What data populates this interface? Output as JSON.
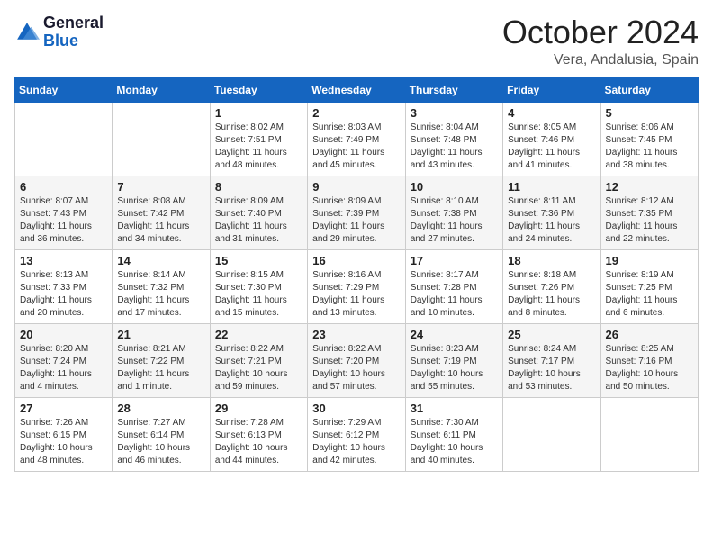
{
  "header": {
    "logo_general": "General",
    "logo_blue": "Blue",
    "month": "October 2024",
    "location": "Vera, Andalusia, Spain"
  },
  "days_of_week": [
    "Sunday",
    "Monday",
    "Tuesday",
    "Wednesday",
    "Thursday",
    "Friday",
    "Saturday"
  ],
  "weeks": [
    [
      {
        "day": "",
        "detail": ""
      },
      {
        "day": "",
        "detail": ""
      },
      {
        "day": "1",
        "detail": "Sunrise: 8:02 AM\nSunset: 7:51 PM\nDaylight: 11 hours and 48 minutes."
      },
      {
        "day": "2",
        "detail": "Sunrise: 8:03 AM\nSunset: 7:49 PM\nDaylight: 11 hours and 45 minutes."
      },
      {
        "day": "3",
        "detail": "Sunrise: 8:04 AM\nSunset: 7:48 PM\nDaylight: 11 hours and 43 minutes."
      },
      {
        "day": "4",
        "detail": "Sunrise: 8:05 AM\nSunset: 7:46 PM\nDaylight: 11 hours and 41 minutes."
      },
      {
        "day": "5",
        "detail": "Sunrise: 8:06 AM\nSunset: 7:45 PM\nDaylight: 11 hours and 38 minutes."
      }
    ],
    [
      {
        "day": "6",
        "detail": "Sunrise: 8:07 AM\nSunset: 7:43 PM\nDaylight: 11 hours and 36 minutes."
      },
      {
        "day": "7",
        "detail": "Sunrise: 8:08 AM\nSunset: 7:42 PM\nDaylight: 11 hours and 34 minutes."
      },
      {
        "day": "8",
        "detail": "Sunrise: 8:09 AM\nSunset: 7:40 PM\nDaylight: 11 hours and 31 minutes."
      },
      {
        "day": "9",
        "detail": "Sunrise: 8:09 AM\nSunset: 7:39 PM\nDaylight: 11 hours and 29 minutes."
      },
      {
        "day": "10",
        "detail": "Sunrise: 8:10 AM\nSunset: 7:38 PM\nDaylight: 11 hours and 27 minutes."
      },
      {
        "day": "11",
        "detail": "Sunrise: 8:11 AM\nSunset: 7:36 PM\nDaylight: 11 hours and 24 minutes."
      },
      {
        "day": "12",
        "detail": "Sunrise: 8:12 AM\nSunset: 7:35 PM\nDaylight: 11 hours and 22 minutes."
      }
    ],
    [
      {
        "day": "13",
        "detail": "Sunrise: 8:13 AM\nSunset: 7:33 PM\nDaylight: 11 hours and 20 minutes."
      },
      {
        "day": "14",
        "detail": "Sunrise: 8:14 AM\nSunset: 7:32 PM\nDaylight: 11 hours and 17 minutes."
      },
      {
        "day": "15",
        "detail": "Sunrise: 8:15 AM\nSunset: 7:30 PM\nDaylight: 11 hours and 15 minutes."
      },
      {
        "day": "16",
        "detail": "Sunrise: 8:16 AM\nSunset: 7:29 PM\nDaylight: 11 hours and 13 minutes."
      },
      {
        "day": "17",
        "detail": "Sunrise: 8:17 AM\nSunset: 7:28 PM\nDaylight: 11 hours and 10 minutes."
      },
      {
        "day": "18",
        "detail": "Sunrise: 8:18 AM\nSunset: 7:26 PM\nDaylight: 11 hours and 8 minutes."
      },
      {
        "day": "19",
        "detail": "Sunrise: 8:19 AM\nSunset: 7:25 PM\nDaylight: 11 hours and 6 minutes."
      }
    ],
    [
      {
        "day": "20",
        "detail": "Sunrise: 8:20 AM\nSunset: 7:24 PM\nDaylight: 11 hours and 4 minutes."
      },
      {
        "day": "21",
        "detail": "Sunrise: 8:21 AM\nSunset: 7:22 PM\nDaylight: 11 hours and 1 minute."
      },
      {
        "day": "22",
        "detail": "Sunrise: 8:22 AM\nSunset: 7:21 PM\nDaylight: 10 hours and 59 minutes."
      },
      {
        "day": "23",
        "detail": "Sunrise: 8:22 AM\nSunset: 7:20 PM\nDaylight: 10 hours and 57 minutes."
      },
      {
        "day": "24",
        "detail": "Sunrise: 8:23 AM\nSunset: 7:19 PM\nDaylight: 10 hours and 55 minutes."
      },
      {
        "day": "25",
        "detail": "Sunrise: 8:24 AM\nSunset: 7:17 PM\nDaylight: 10 hours and 53 minutes."
      },
      {
        "day": "26",
        "detail": "Sunrise: 8:25 AM\nSunset: 7:16 PM\nDaylight: 10 hours and 50 minutes."
      }
    ],
    [
      {
        "day": "27",
        "detail": "Sunrise: 7:26 AM\nSunset: 6:15 PM\nDaylight: 10 hours and 48 minutes."
      },
      {
        "day": "28",
        "detail": "Sunrise: 7:27 AM\nSunset: 6:14 PM\nDaylight: 10 hours and 46 minutes."
      },
      {
        "day": "29",
        "detail": "Sunrise: 7:28 AM\nSunset: 6:13 PM\nDaylight: 10 hours and 44 minutes."
      },
      {
        "day": "30",
        "detail": "Sunrise: 7:29 AM\nSunset: 6:12 PM\nDaylight: 10 hours and 42 minutes."
      },
      {
        "day": "31",
        "detail": "Sunrise: 7:30 AM\nSunset: 6:11 PM\nDaylight: 10 hours and 40 minutes."
      },
      {
        "day": "",
        "detail": ""
      },
      {
        "day": "",
        "detail": ""
      }
    ]
  ]
}
